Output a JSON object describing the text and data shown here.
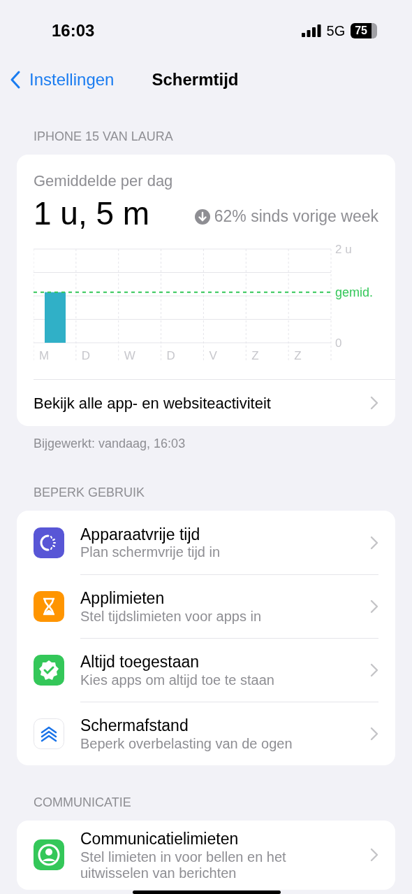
{
  "status_bar": {
    "time": "16:03",
    "network": "5G",
    "battery": "75"
  },
  "nav": {
    "back": "Instellingen",
    "title": "Schermtijd"
  },
  "sections": [
    {
      "header": "IPHONE 15 VAN LAURA",
      "kind": "summary",
      "subtitle": "Gemiddelde per dag",
      "total": "1 u, 5 m",
      "trend": "62% sinds vorige week",
      "chart_data": {
        "type": "bar",
        "categories": [
          "M",
          "D",
          "W",
          "D",
          "V",
          "Z",
          "Z"
        ],
        "series": [
          {
            "color": "#30b0c7",
            "values": [
              1.08,
              0,
              0,
              0,
              0,
              0,
              0
            ]
          }
        ],
        "ylim": [
          0,
          2
        ],
        "yticks": [
          0,
          {
            "value": 2,
            "label": "2 u"
          }
        ]
      },
      "average_label": "gemid.",
      "link": "Bekijk alle app- en websiteactiviteit",
      "footer": "Bijgewerkt: vandaag, 16:03"
    },
    {
      "header": "BEPERK GEBRUIK",
      "kind": "list",
      "items": [
        {
          "title": "Apparaatvrije tijd",
          "subtitle": "Plan schermvrije tijd in"
        },
        {
          "title": "Applimieten",
          "subtitle": "Stel tijdslimieten voor apps in"
        },
        {
          "title": "Altijd toegestaan",
          "subtitle": "Kies apps om altijd toe te staan"
        },
        {
          "title": "Schermafstand",
          "subtitle": "Beperk overbelasting van de ogen"
        }
      ]
    },
    {
      "header": "COMMUNICATIE",
      "kind": "list",
      "items": [
        {
          "title": "Communicatielimieten",
          "subtitle": "Stel limieten in voor bellen en het uitwisselen van berichten"
        }
      ]
    }
  ]
}
